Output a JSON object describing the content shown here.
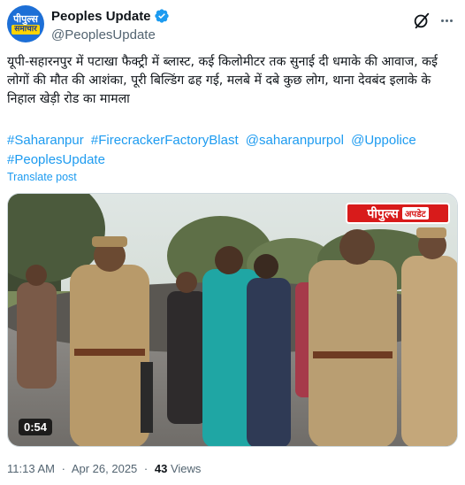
{
  "author": {
    "avatar_line1": "पीपुल्स",
    "avatar_line2": "समाचार",
    "display_name": "Peoples Update",
    "handle": "@PeoplesUpdate",
    "verified_color": "#1d9bf0"
  },
  "tweet": {
    "text": "यूपी-सहारनपुर में पटाखा फैक्ट्री में ब्लास्ट, कई किलोमीटर तक सुनाई दी धमाके की आवाज, कई लोगों की मौत की आशंका, पूरी बिल्डिंग ढह गई, मलबे में दबे कुछ लोग, थाना देवबंद इलाके के निहाल खेड़ी रोड का मामला",
    "hashtags": [
      "#Saharanpur",
      "#FirecrackerFactoryBlast",
      "@saharanpurpol",
      "@Uppolice",
      "#PeoplesUpdate"
    ],
    "translate_label": "Translate post"
  },
  "media": {
    "brand_main": "पीपुल्स",
    "brand_sub": "अपडेट",
    "duration": "0:54"
  },
  "meta": {
    "time": "11:13 AM",
    "date": "Apr 26, 2025",
    "separator": "·",
    "views_count": "43",
    "views_label": "Views"
  },
  "icons": {
    "grok": "grok-icon",
    "more": "more-icon"
  },
  "colors": {
    "link": "#1d9bf0",
    "muted": "#536471",
    "text": "#0f1419",
    "brand_red": "#d81b1b"
  }
}
